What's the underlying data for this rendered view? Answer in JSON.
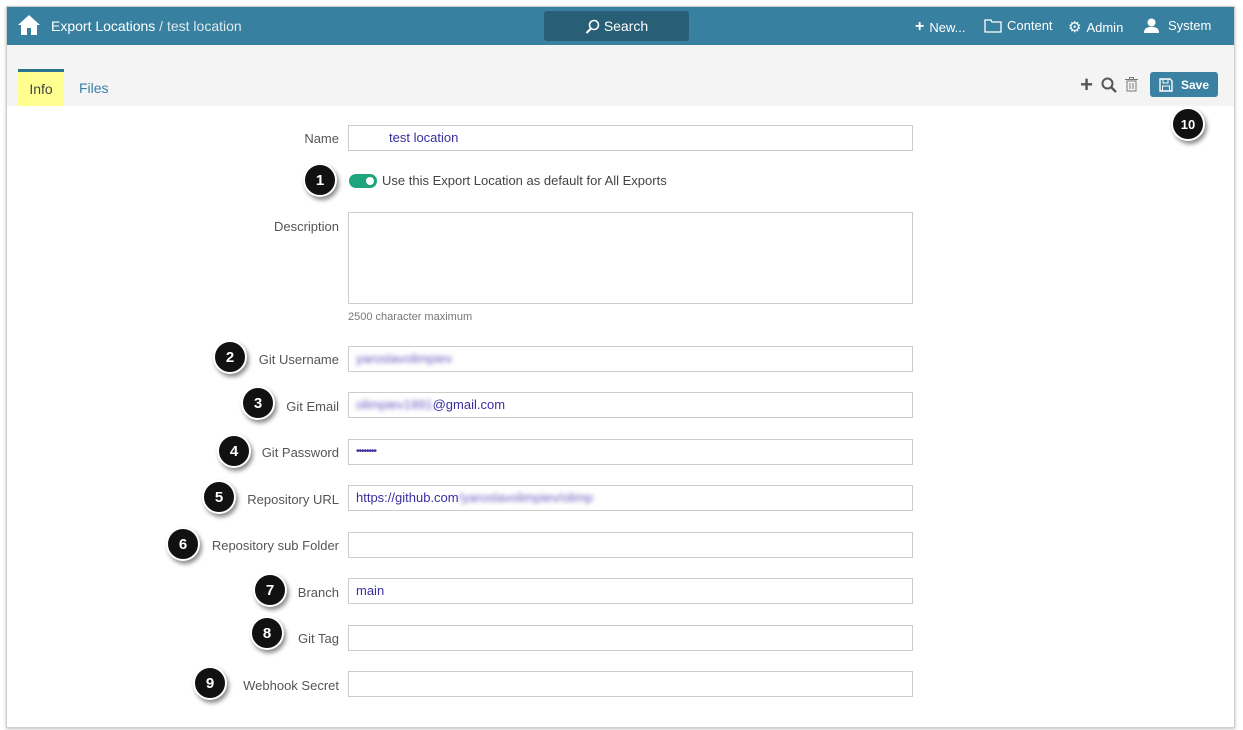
{
  "header": {
    "breadcrumb_root": "Export Locations",
    "breadcrumb_sep": " / ",
    "breadcrumb_current": "test location",
    "search_label": "Search",
    "new_label": "New...",
    "content_label": "Content",
    "admin_label": "Admin",
    "user_label": "System"
  },
  "tabs": [
    {
      "label": "Info"
    },
    {
      "label": "Files"
    }
  ],
  "toolbar": {
    "save_label": "Save"
  },
  "form": {
    "name_label": "Name",
    "name_value": "test location",
    "default_toggle_label": "Use this Export Location as default for All Exports",
    "default_toggle_on": true,
    "description_label": "Description",
    "description_value": "",
    "description_hint": "2500 character maximum",
    "git_username_label": "Git Username",
    "git_username_value": "yaroslavolimpiev",
    "git_email_label": "Git Email",
    "git_email_blurred": "olimpiev1991",
    "git_email_value": "@gmail.com",
    "git_password_label": "Git Password",
    "git_password_value": "••••••••",
    "repo_url_label": "Repository URL",
    "repo_url_value": "https://github.com",
    "repo_url_blurred": "/yaroslavolimpiev/olimp",
    "repo_subfolder_label": "Repository sub Folder",
    "repo_subfolder_value": "",
    "branch_label": "Branch",
    "branch_value": "main",
    "git_tag_label": "Git Tag",
    "git_tag_value": "",
    "webhook_label": "Webhook Secret",
    "webhook_value": ""
  },
  "badges": [
    "1",
    "2",
    "3",
    "4",
    "5",
    "6",
    "7",
    "8",
    "9",
    "10"
  ]
}
